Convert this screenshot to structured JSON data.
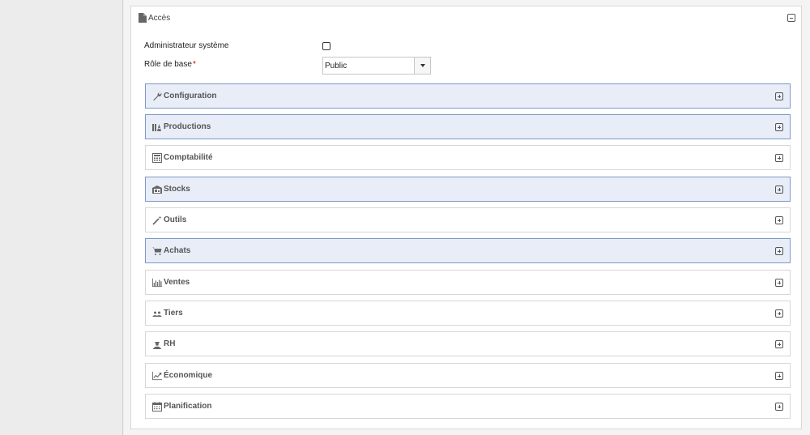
{
  "panel": {
    "title": "Accès",
    "title_icon": "document-icon",
    "collapse_icon": "collapse-minus-icon"
  },
  "form": {
    "admin_label": "Administrateur système",
    "admin_checked": false,
    "role_label": "Rôle de base",
    "role_required_mark": "*",
    "role_value": "Public"
  },
  "sections": [
    {
      "label": "Configuration",
      "icon": "wrench-icon",
      "highlighted": true
    },
    {
      "label": "Productions",
      "icon": "production-icon",
      "highlighted": true
    },
    {
      "label": "Comptabilité",
      "icon": "calculator-icon",
      "highlighted": false
    },
    {
      "label": "Stocks",
      "icon": "warehouse-icon",
      "highlighted": true
    },
    {
      "label": "Outils",
      "icon": "magic-wand-icon",
      "highlighted": false
    },
    {
      "label": "Achats",
      "icon": "cart-icon",
      "highlighted": true
    },
    {
      "label": "Ventes",
      "icon": "bar-chart-icon",
      "highlighted": false
    },
    {
      "label": "Tiers",
      "icon": "people-icon",
      "highlighted": false
    },
    {
      "label": "RH",
      "icon": "person-icon",
      "highlighted": false
    },
    {
      "label": "Économique",
      "icon": "line-chart-icon",
      "highlighted": false
    },
    {
      "label": "Planification",
      "icon": "calendar-icon",
      "highlighted": false
    }
  ],
  "colors": {
    "highlight_bg": "#e8edf7",
    "highlight_border": "#7f98c9",
    "required": "#cc0000"
  }
}
